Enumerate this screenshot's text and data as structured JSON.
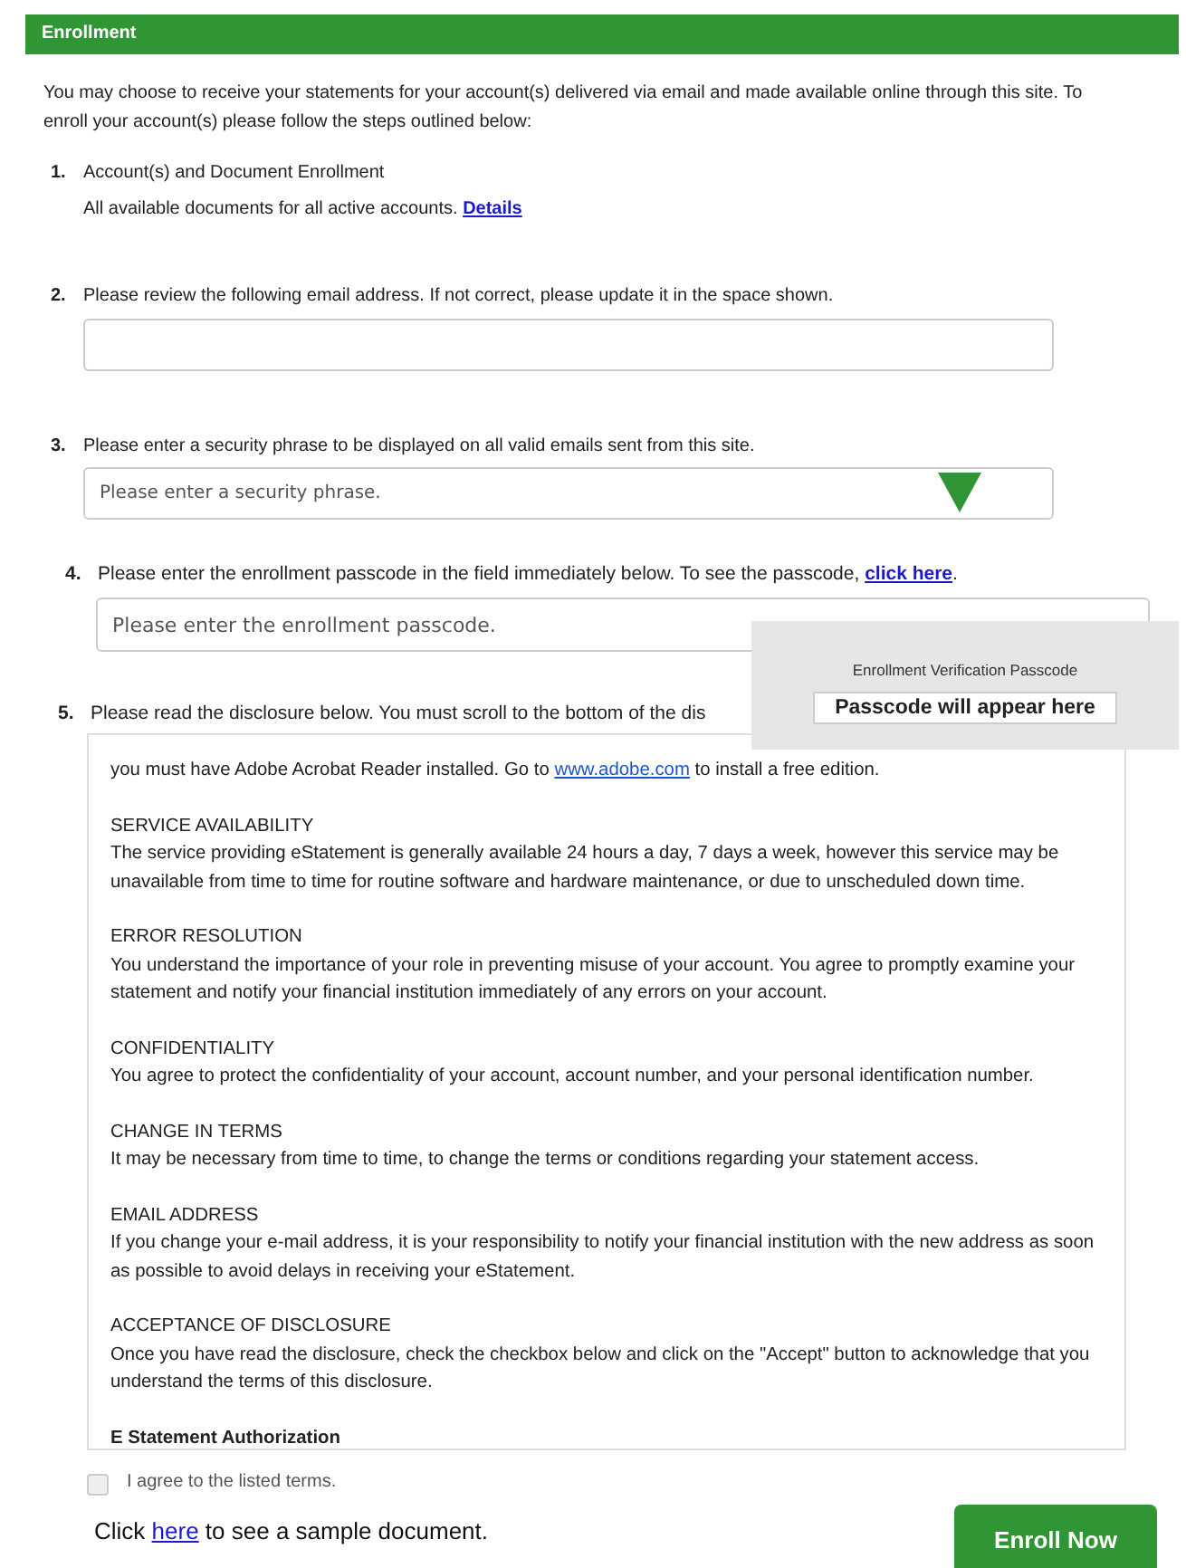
{
  "header": {
    "title": "Enrollment"
  },
  "intro": "You may choose to receive your statements for your account(s) delivered via email and made available online through this site. To enroll your account(s) please follow the steps outlined below:",
  "steps": [
    {
      "kind": "info",
      "number": "1.",
      "title": "Account(s) and Document Enrollment",
      "text": "All available documents for all active accounts.",
      "link": "Details"
    },
    {
      "kind": "field",
      "number": "2.",
      "title": "Please review the following email address. If not correct, please update it in the space shown."
    },
    {
      "kind": "field",
      "number": "3.",
      "title": "Please enter a security phrase to be displayed on all valid emails sent from this site.",
      "placeholder": "Please enter a security phrase."
    },
    {
      "kind": "linkfield",
      "number": "4.",
      "title": "Please enter the enrollment passcode in the field immediately below. To see the passcode,",
      "link": "click here",
      "after": ".",
      "placeholder": "Please enter the enrollment passcode."
    },
    {
      "kind": "disclosure",
      "number": "5.",
      "title": "Please read the disclosure below. You must scroll to the bottom of the dis"
    }
  ],
  "disclosure": {
    "lead": {
      "before": "you must have Adobe Acrobat Reader installed. Go to ",
      "link": "www.adobe.com",
      "after": " to install a free edition."
    },
    "sections": [
      {
        "heading": "SERVICE AVAILABILITY",
        "body": "The service providing eStatement is generally available 24 hours a day, 7 days a week, however this service may be unavailable from time to time for routine software and hardware maintenance, or due to unscheduled down time."
      },
      {
        "heading": "ERROR RESOLUTION",
        "body": "You understand the importance of your role in preventing misuse of your account. You agree to promptly examine your statement and notify your financial institution immediately of any errors on your account."
      },
      {
        "heading": "CONFIDENTIALITY",
        "body": "You agree to protect the confidentiality of your account, account number, and your personal identification number."
      },
      {
        "heading": "CHANGE IN TERMS",
        "body": "It may be necessary from time to time, to change the terms or conditions regarding your statement access."
      },
      {
        "heading": "EMAIL ADDRESS",
        "body": "If you change your e-mail address, it is your responsibility to notify your financial institution with the new address as soon as possible to avoid delays in receiving your eStatement."
      },
      {
        "heading": "ACCEPTANCE OF DISCLOSURE",
        "body": "Once you have read the disclosure, check the checkbox below and click on the \"Accept\" button to acknowledge that you understand the terms of this disclosure."
      }
    ],
    "final_heading": "E Statement Authorization"
  },
  "popup": {
    "title": "Enrollment Verification Passcode",
    "value": "Passcode will appear here"
  },
  "agree": {
    "label": "I agree to the listed terms.",
    "checked": false
  },
  "sample": {
    "before": "Click ",
    "link": "here",
    "after": " to see a sample document."
  },
  "enroll_button": "Enroll Now"
}
